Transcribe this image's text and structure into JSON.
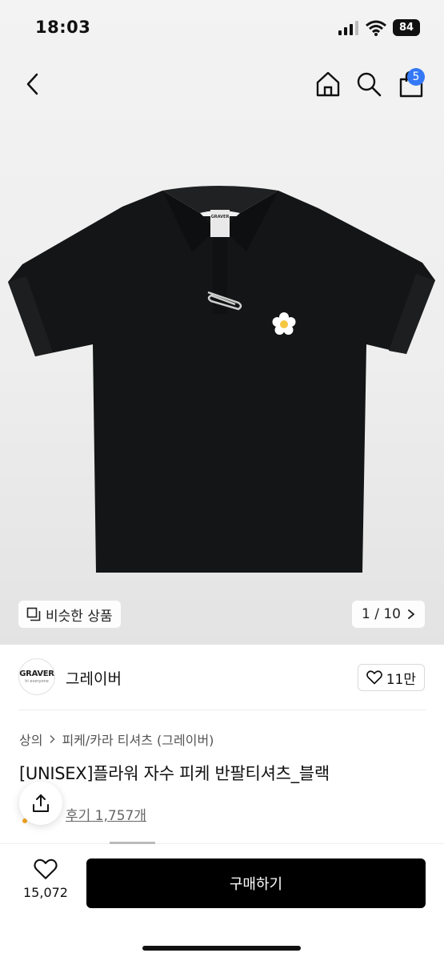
{
  "status_bar": {
    "time": "18:03",
    "battery": "84"
  },
  "nav": {
    "cart_count": "5"
  },
  "image": {
    "similar_label": "비슷한 상품",
    "counter": "1 / 10",
    "shirt_logo": "GRAVER"
  },
  "brand": {
    "logo_text": "GRAVER",
    "logo_sub": "hi everyone",
    "name": "그레이버",
    "likes": "11만"
  },
  "breadcrumb": {
    "category": "상의",
    "subcategory": "피케/카라 티셔츠 (그레이버)"
  },
  "product": {
    "title": "[UNISEX]플라워 자수 피케 반팔티셔츠_블랙",
    "reviews": "후기 1,757개"
  },
  "bottom": {
    "wish_count": "15,072",
    "buy_label": "구매하기"
  },
  "colors": {
    "accent": "#3478f6",
    "buy_button": "#000000",
    "shirt": "#141516"
  }
}
